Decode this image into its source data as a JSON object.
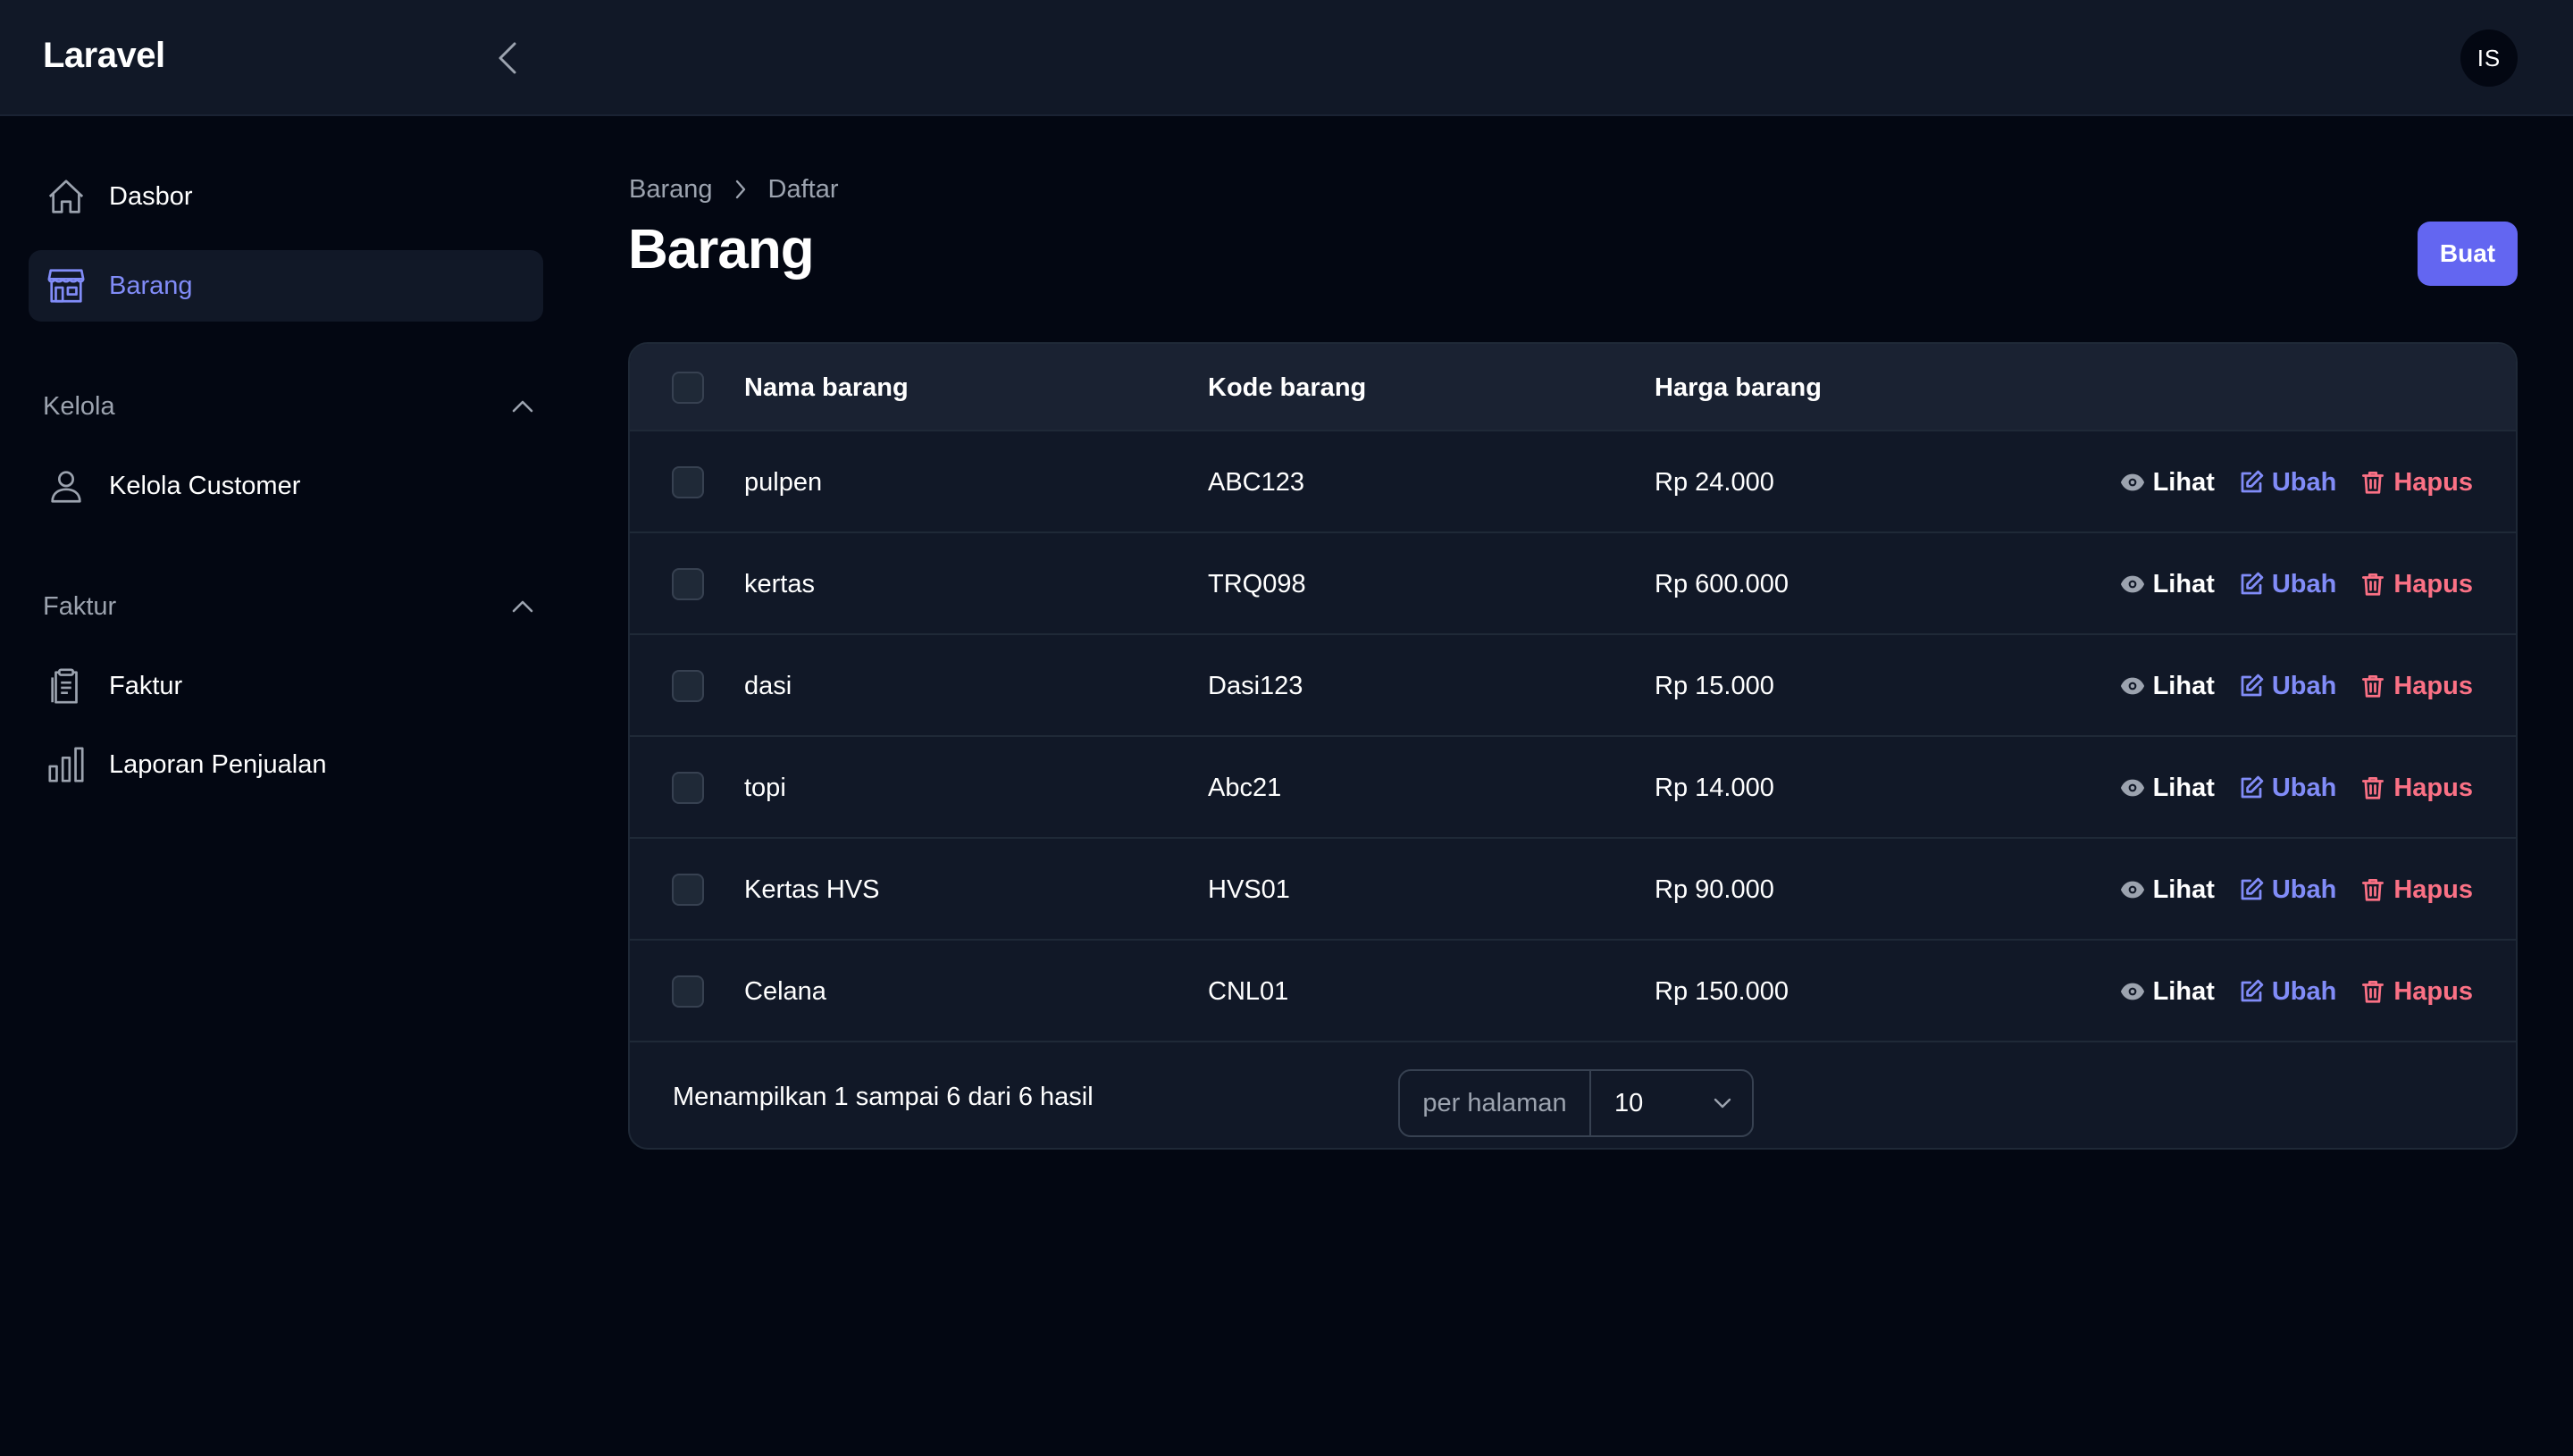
{
  "topbar": {
    "brand": "Laravel",
    "user_initials": "IS"
  },
  "sidebar": {
    "items": [
      {
        "label": "Dasbor",
        "icon": "home-icon"
      },
      {
        "label": "Barang",
        "icon": "storefront-icon",
        "active": true
      }
    ],
    "groups": [
      {
        "label": "Kelola",
        "items": [
          {
            "label": "Kelola Customer",
            "icon": "user-icon"
          }
        ]
      },
      {
        "label": "Faktur",
        "items": [
          {
            "label": "Faktur",
            "icon": "clipboard-icon"
          },
          {
            "label": "Laporan Penjualan",
            "icon": "bar-chart-icon"
          }
        ]
      }
    ]
  },
  "breadcrumb": {
    "items": [
      "Barang",
      "Daftar"
    ]
  },
  "page": {
    "title": "Barang",
    "create_label": "Buat"
  },
  "table": {
    "headers": {
      "name": "Nama barang",
      "code": "Kode barang",
      "price": "Harga barang"
    },
    "action_labels": {
      "view": "Lihat",
      "edit": "Ubah",
      "delete": "Hapus"
    },
    "rows": [
      {
        "name": "pulpen",
        "code": "ABC123",
        "price": "Rp 24.000"
      },
      {
        "name": "kertas",
        "code": "TRQ098",
        "price": "Rp 600.000"
      },
      {
        "name": "dasi",
        "code": "Dasi123",
        "price": "Rp 15.000"
      },
      {
        "name": "topi",
        "code": "Abc21",
        "price": "Rp 14.000"
      },
      {
        "name": "Kertas HVS",
        "code": "HVS01",
        "price": "Rp 90.000"
      },
      {
        "name": "Celana",
        "code": "CNL01",
        "price": "Rp 150.000"
      }
    ],
    "summary": "Menampilkan 1 sampai 6 dari 6 hasil",
    "per_page_label": "per halaman",
    "per_page_value": "10"
  },
  "colors": {
    "background": "#030712",
    "panel": "#111827",
    "accent": "#6366f1",
    "accent_text": "#818cf8",
    "danger": "#fb7185"
  }
}
